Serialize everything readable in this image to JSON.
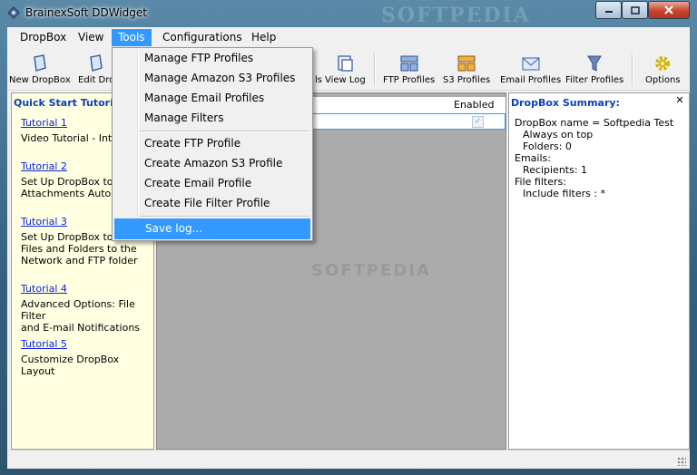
{
  "window": {
    "title": "BrainexSoft DDWidget",
    "watermark": "SOFTPEDIA"
  },
  "menubar": {
    "items": [
      "DropBox",
      "View",
      "Tools",
      "Configurations",
      "Help"
    ],
    "active": "Tools"
  },
  "toolbar": {
    "buttons": [
      {
        "label": "New DropBox",
        "icon": "new-dropbox-icon"
      },
      {
        "label": "Edit Dro",
        "icon": "edit-dropbox-icon"
      },
      {
        "label": "ls",
        "icon": "tools-icon"
      },
      {
        "label": "View Log",
        "icon": "view-log-icon"
      },
      {
        "label": "FTP Profiles",
        "icon": "ftp-profiles-icon"
      },
      {
        "label": "S3 Profiles",
        "icon": "s3-profiles-icon"
      },
      {
        "label": "Email Profiles",
        "icon": "email-profiles-icon"
      },
      {
        "label": "Filter Profiles",
        "icon": "filter-profiles-icon"
      },
      {
        "label": "Options",
        "icon": "gear-icon"
      }
    ]
  },
  "tools_menu": {
    "items": [
      {
        "label": "Manage FTP Profiles"
      },
      {
        "label": "Manage Amazon S3 Profiles"
      },
      {
        "label": "Manage Email Profiles"
      },
      {
        "label": "Manage Filters"
      },
      {
        "label": "Create FTP Profile"
      },
      {
        "label": "Create Amazon S3 Profile"
      },
      {
        "label": "Create Email Profile"
      },
      {
        "label": "Create File Filter Profile"
      },
      {
        "label": "Save log..."
      }
    ],
    "highlighted": "Save log..."
  },
  "quick_start": {
    "title": "Quick Start Tutorials",
    "tutorials": [
      {
        "link": "Tutorial 1",
        "desc": "Video Tutorial - Intro"
      },
      {
        "link": "Tutorial 2",
        "desc": "Set Up DropBox to S\nAttachments Automa"
      },
      {
        "link": "Tutorial 3",
        "desc": "Set Up DropBox to T\nFiles and Folders to the\nNetwork and FTP folder"
      },
      {
        "link": "Tutorial 4",
        "desc": "Advanced Options: File Filter\nand E-mail Notifications"
      },
      {
        "link": "Tutorial 5",
        "desc": "Customize DropBox Layout"
      }
    ]
  },
  "grid": {
    "enabled_header": "Enabled",
    "row_enabled": true
  },
  "summary": {
    "title": "DropBox Summary:",
    "close": "✕",
    "lines": [
      "DropBox name = Softpedia Test",
      "Always on top",
      "Folders: 0",
      "Emails:",
      "Recipients: 1",
      "File filters:",
      "Include filters : *"
    ]
  },
  "colors": {
    "menu_highlight": "#3399ff",
    "panel_yellow": "#ffffe1",
    "link_blue": "#0a24d8",
    "title_blue": "#0a42b8"
  }
}
